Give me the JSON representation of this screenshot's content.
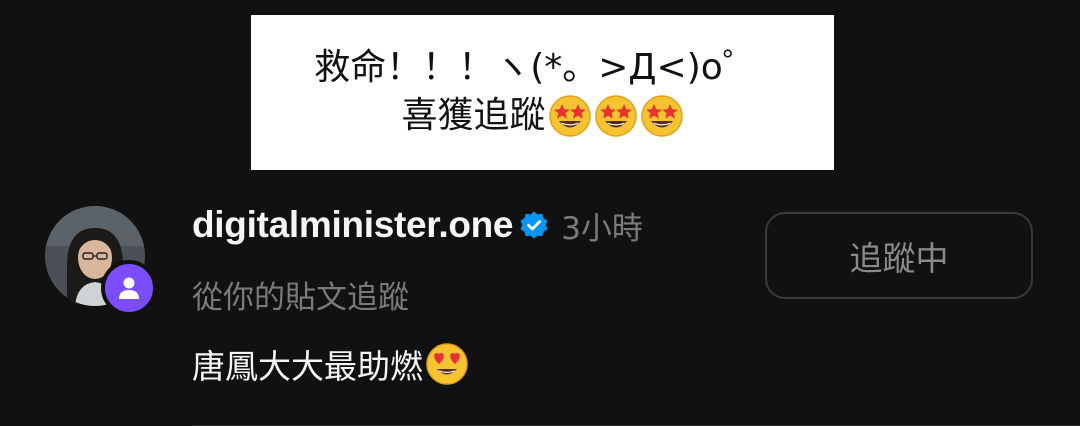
{
  "caption": {
    "line1": "救命！！！ヽ(*。>Д<)o゜",
    "line2": "喜獲追蹤",
    "line2_emojis": [
      "star-struck-emoji",
      "star-struck-emoji",
      "star-struck-emoji"
    ]
  },
  "notification": {
    "avatar_icon": "profile-photo",
    "badge_icon": "person-icon",
    "badge_color": "#7b4dff",
    "username": "digitalminister.one",
    "verified_icon": "verified-badge-icon",
    "verified_color": "#0095f6",
    "timestamp": "3小時",
    "subtitle": "從你的貼文追蹤",
    "comment": "唐鳳大大最助燃",
    "comment_emoji": "heart-eyes-emoji",
    "follow_button_label": "追蹤中"
  }
}
